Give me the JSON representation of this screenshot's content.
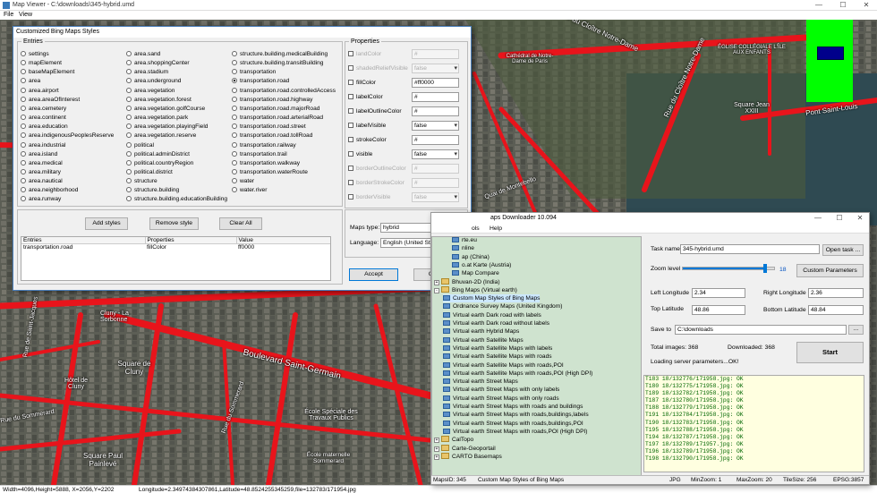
{
  "viewer": {
    "title": "Map Viewer - C:\\downloads\\345-hybrid.umd",
    "menu": [
      "File",
      "View"
    ],
    "status_left": "Width=4096,Height=5888, X=2056,Y=2202",
    "status_right": "Longitude=2.34974384307861,Latitude=48.8524255345259,file=132783/171954.jpg"
  },
  "map_labels": [
    "Rue du Cloître Notre-Dame",
    "Rue du Cloître Notre-Dame",
    "Cathédral de Notre-Dame de Paris",
    "Square Jean XXIII",
    "Pont Saint-Louis",
    "ÉGLISE COLLÉGIALE L'ÎLE AUX ENFANTS",
    "Square de Cluny",
    "Hôtel de Cluny",
    "Cluny - La Sorbonne",
    "Boulevard Saint-Germain",
    "École Spéciale des Travaux Publics",
    "Square Paul Painlevé",
    "École maternelle Sommerard",
    "Rue du Sommerard",
    "Rue du Sommerard",
    "Quai de Montebello",
    "Rue de Saint-Jacques"
  ],
  "styles_dialog": {
    "title": "Customized Bing Maps Styles",
    "entries_legend": "Entries",
    "properties_legend": "Properties",
    "entries_col1": [
      "settings",
      "mapElement",
      "baseMapElement",
      "area",
      "area.airport",
      "area.areaOfInterest",
      "area.cemetery",
      "area.continent",
      "area.education",
      "area.indigenousPeoplesReserve",
      "area.industrial",
      "area.island",
      "area.medical",
      "area.military",
      "area.nautical",
      "area.neighborhood",
      "area.runway"
    ],
    "entries_col2": [
      "area.sand",
      "area.shoppingCenter",
      "area.stadium",
      "area.underground",
      "area.vegetation",
      "area.vegetation.forest",
      "area.vegetation.golfCourse",
      "area.vegetation.park",
      "area.vegetation.playingField",
      "area.vegetation.reserve",
      "political",
      "political.adminDistrict",
      "political.countryRegion",
      "political.district",
      "structure",
      "structure.building",
      "structure.building.educationBuilding"
    ],
    "entries_col3": [
      "structure.building.medicalBuilding",
      "structure.building.transitBuilding",
      "transportation",
      "transportation.road",
      "transportation.road.controlledAccess",
      "transportation.road.highway",
      "transportation.road.majorRoad",
      "transportation.road.arterialRoad",
      "transportation.road.street",
      "transportation.road.tollRoad",
      "transportation.railway",
      "transportation.trail",
      "transportation.walkway",
      "transportation.waterRoute",
      "water",
      "water.river"
    ],
    "selected_entry": "transportation.road",
    "properties": [
      {
        "label": "landColor",
        "value": "#",
        "enabled": false,
        "kind": "text"
      },
      {
        "label": "shadedReliefVisible",
        "value": "false",
        "enabled": false,
        "kind": "select"
      },
      {
        "label": "fillColor",
        "value": "#ff0000",
        "enabled": true,
        "kind": "text"
      },
      {
        "label": "labelColor",
        "value": "#",
        "enabled": true,
        "kind": "text"
      },
      {
        "label": "labelOutlineColor",
        "value": "#",
        "enabled": true,
        "kind": "text"
      },
      {
        "label": "labelVisible",
        "value": "false",
        "enabled": true,
        "kind": "select"
      },
      {
        "label": "strokeColor",
        "value": "#",
        "enabled": true,
        "kind": "text"
      },
      {
        "label": "visible",
        "value": "false",
        "enabled": true,
        "kind": "select"
      },
      {
        "label": "borderOutlineColor",
        "value": "#",
        "enabled": false,
        "kind": "text"
      },
      {
        "label": "borderStrokeColor",
        "value": "#",
        "enabled": false,
        "kind": "text"
      },
      {
        "label": "borderVisible",
        "value": "false",
        "enabled": false,
        "kind": "select"
      }
    ],
    "add_styles": "Add styles",
    "remove_style": "Remove style",
    "clear_all": "Clear All",
    "table_headers": [
      "Entries",
      "Properties",
      "Value"
    ],
    "table_rows": [
      [
        "transportation.road",
        "fillColor",
        "ff0000"
      ]
    ],
    "maps_type_label": "Maps type:",
    "maps_type_value": "hybrid",
    "language_label": "Language:",
    "language_value": "English (United States)",
    "accept": "Accept",
    "cancel": "Cancel"
  },
  "downloader": {
    "title": "aps Downloader 10.094",
    "menu": [
      "ols",
      "Help"
    ],
    "tree": [
      {
        "indent": 2,
        "type": "item",
        "label": "rte.eu"
      },
      {
        "indent": 2,
        "type": "item",
        "label": "nline"
      },
      {
        "indent": 2,
        "type": "item",
        "label": "ap (China)"
      },
      {
        "indent": 2,
        "type": "item",
        "label": "o.at Karte (Austria)"
      },
      {
        "indent": 2,
        "type": "item",
        "label": "Map Compare"
      },
      {
        "indent": 0,
        "type": "folder",
        "label": "Bhuvan-2D (India)",
        "pm": "+"
      },
      {
        "indent": 0,
        "type": "folder",
        "label": "Bing Maps (Virtual earth)",
        "pm": "-"
      },
      {
        "indent": 1,
        "type": "item",
        "label": "Custom Map Styles of Bing Maps",
        "selected": true
      },
      {
        "indent": 1,
        "type": "item",
        "label": "Ordnance Survey Maps (United Kingdom)"
      },
      {
        "indent": 1,
        "type": "item",
        "label": "Virtual earth Dark road with labels"
      },
      {
        "indent": 1,
        "type": "item",
        "label": "Virtual earth Dark road without labels"
      },
      {
        "indent": 1,
        "type": "item",
        "label": "Virtual earth Hybrid Maps"
      },
      {
        "indent": 1,
        "type": "item",
        "label": "Virtual earth Satellite Maps"
      },
      {
        "indent": 1,
        "type": "item",
        "label": "Virtual earth Satellite Maps with labels"
      },
      {
        "indent": 1,
        "type": "item",
        "label": "Virtual earth Satellite Maps with roads"
      },
      {
        "indent": 1,
        "type": "item",
        "label": "Virtual earth Satellite Maps with roads,POI"
      },
      {
        "indent": 1,
        "type": "item",
        "label": "Virtual earth Satellite Maps with roads,POI (High DPI)"
      },
      {
        "indent": 1,
        "type": "item",
        "label": "Virtual earth Street Maps"
      },
      {
        "indent": 1,
        "type": "item",
        "label": "Virtual earth Street Maps with only labels"
      },
      {
        "indent": 1,
        "type": "item",
        "label": "Virtual earth Street Maps with only roads"
      },
      {
        "indent": 1,
        "type": "item",
        "label": "Virtual earth Street Maps with roads and buildings"
      },
      {
        "indent": 1,
        "type": "item",
        "label": "Virtual earth Street Maps with roads,buildings,labels"
      },
      {
        "indent": 1,
        "type": "item",
        "label": "Virtual earth Street Maps with roads,buildings,POI"
      },
      {
        "indent": 1,
        "type": "item",
        "label": "Virtual earth Street Maps with roads,POI (High DPI)"
      },
      {
        "indent": 0,
        "type": "folder",
        "label": "CalTopo",
        "pm": "+"
      },
      {
        "indent": 0,
        "type": "folder",
        "label": "Carte-Geoportail",
        "pm": "+"
      },
      {
        "indent": 0,
        "type": "folder",
        "label": "CARTO Basemaps",
        "pm": "+"
      }
    ],
    "task_name_label": "Task name",
    "task_name_value": "345-hybrid.umd",
    "open_task": "Open task ...",
    "zoom_label": "Zoom level",
    "zoom_value": "18",
    "zoom_fraction": 0.9,
    "custom_params": "Custom Parameters",
    "left_lon_label": "Left Longitude",
    "left_lon_value": "2.34",
    "right_lon_label": "Right Longitude",
    "right_lon_value": "2.36",
    "top_lat_label": "Top Latitude",
    "top_lat_value": "48.86",
    "bottom_lat_label": "Bottom Latitude",
    "bottom_lat_value": "48.84",
    "save_to_label": "Save to",
    "save_to_value": "C:\\downloads",
    "browse": "...",
    "total_images": "Total images: 368",
    "downloaded": "Downloaded: 368",
    "loading": "Loading server parameters...OK!",
    "start": "Start",
    "log": [
      "T183 18/132776/171958.jpg: OK",
      "T180 18/132775/171958.jpg: OK",
      "T189 18/132782/171958.jpg: OK",
      "T187 18/132780/171958.jpg: OK",
      "T188 18/132779/171958.jpg: OK",
      "T191 18/132784/171958.jpg: OK",
      "T190 18/132783/171958.jpg: OK",
      "T195 18/132788/171958.jpg: OK",
      "T194 18/132787/171958.jpg: OK",
      "T197 18/132789/171957.jpg: OK",
      "T196 18/132789/171958.jpg: OK",
      "T198 18/132790/171958.jpg: OK"
    ],
    "status": [
      "MapsID: 345",
      "Custom Map Styles of Bing Maps",
      "JPG",
      "MinZoom: 1",
      "MaxZoom: 20",
      "TileSize: 256",
      "EPSG:3857"
    ]
  },
  "colors": {
    "road": "#e8141b",
    "minimap_bg": "#00ff00",
    "minimap_rect": "#00008b",
    "tree_bg": "#cfe3cf",
    "log_bg": "#ffffe0"
  }
}
